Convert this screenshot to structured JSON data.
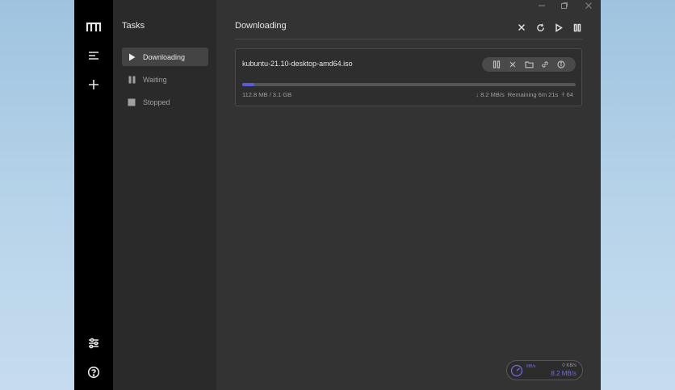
{
  "window_controls": {
    "minimize_icon": "minimize-icon",
    "maximize_icon": "maximize-icon",
    "close_icon": "close-icon"
  },
  "rail": {
    "logo_icon": "motrix-logo-icon",
    "items": [
      "menu-icon",
      "add-icon",
      "settings-sliders-icon",
      "help-icon"
    ]
  },
  "sidebar": {
    "title": "Tasks",
    "items": [
      {
        "label": "Downloading",
        "icon": "play-icon",
        "active": true
      },
      {
        "label": "Waiting",
        "icon": "pause-icon",
        "active": false
      },
      {
        "label": "Stopped",
        "icon": "stop-icon",
        "active": false
      }
    ]
  },
  "main": {
    "title": "Downloading",
    "toolbar": [
      "close-icon",
      "refresh-icon",
      "play-icon",
      "pause-icon"
    ]
  },
  "task": {
    "filename": "kubuntu-21.10-desktop-amd64.iso",
    "progress_fraction": 0.036,
    "size_text": "112.8 MB / 3.1 GB",
    "speed_text": "↓ 8.2 MB/s",
    "remaining_text": "Remaining 6m 21s",
    "connections_text": "⫩ 64",
    "actions": [
      "pause-icon",
      "delete-icon",
      "folder-icon",
      "link-icon",
      "info-icon"
    ]
  },
  "speedometer": {
    "upload": "0 KB/s",
    "download": "8.2 MB/s",
    "tag": "MB/s"
  },
  "colors": {
    "accent": "#5b5bd6",
    "rail": "#000000",
    "sidebar": "#2a2a2a",
    "main": "#333333"
  }
}
